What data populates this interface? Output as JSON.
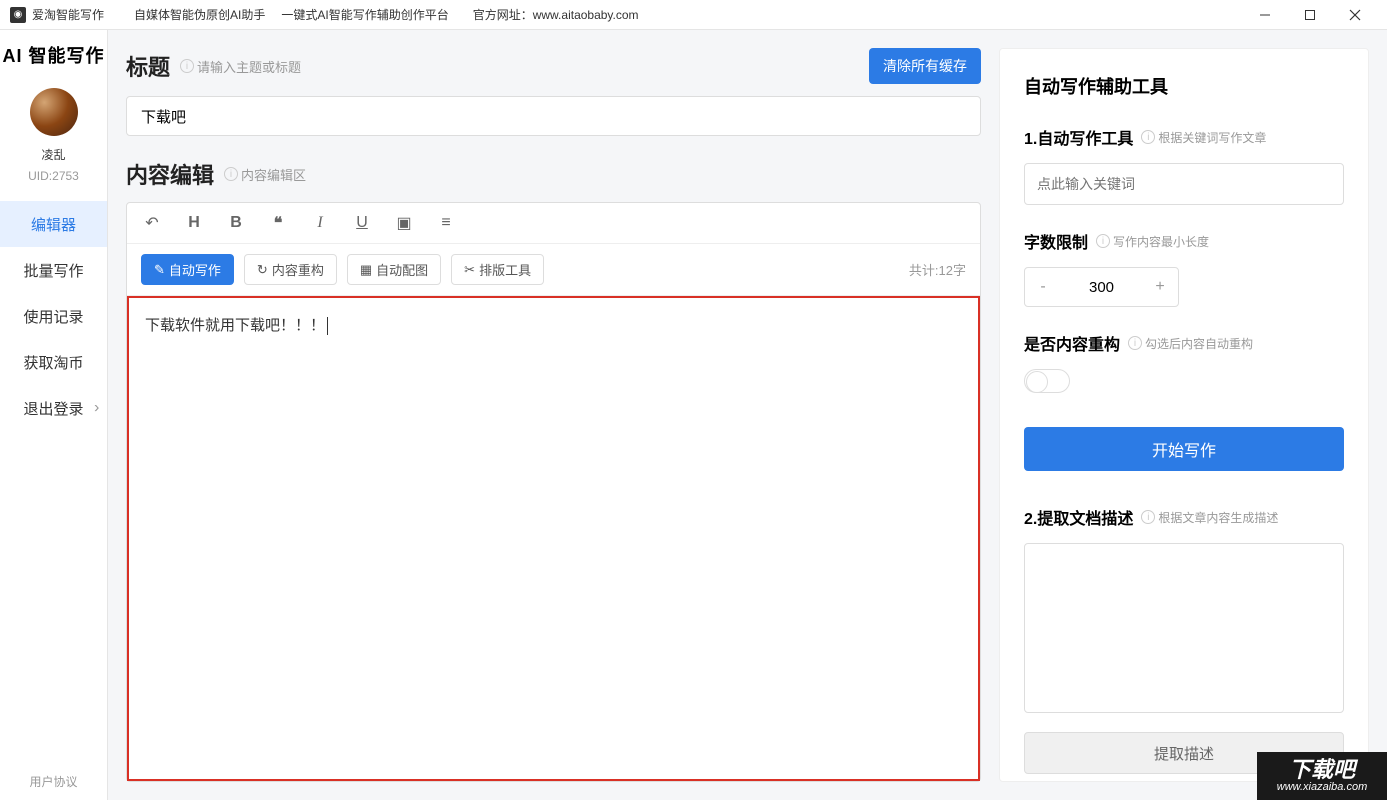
{
  "titlebar": {
    "app_name": "爱淘智能写作",
    "subtitle1": "自媒体智能伪原创AI助手",
    "subtitle2": "一键式AI智能写作辅助创作平台",
    "website_label": "官方网址：",
    "website": "www.aitaobaby.com"
  },
  "sidebar": {
    "logo": "AI 智能写作",
    "username": "凌乱",
    "uid": "UID:2753",
    "nav": {
      "editor": "编辑器",
      "batch": "批量写作",
      "history": "使用记录",
      "coins": "获取淘币",
      "logout": "退出登录"
    },
    "agreement": "用户协议"
  },
  "editor": {
    "title_label": "标题",
    "title_hint": "请输入主题或标题",
    "title_value": "下载吧",
    "clear_cache": "清除所有缓存",
    "content_label": "内容编辑",
    "content_hint": "内容编辑区",
    "actions": {
      "auto_write": "自动写作",
      "restructure": "内容重构",
      "auto_image": "自动配图",
      "layout_tool": "排版工具"
    },
    "char_count": "共计:12字",
    "content_text": "下载软件就用下载吧！！！"
  },
  "side_panel": {
    "title": "自动写作辅助工具",
    "section1": {
      "label": "1.自动写作工具",
      "hint": "根据关键词写作文章",
      "keyword_placeholder": "点此输入关键词"
    },
    "word_limit": {
      "label": "字数限制",
      "hint": "写作内容最小长度",
      "value": "300"
    },
    "restructure": {
      "label": "是否内容重构",
      "hint": "勾选后内容自动重构"
    },
    "start_button": "开始写作",
    "section2": {
      "label": "2.提取文档描述",
      "hint": "根据文章内容生成描述"
    },
    "extract_button": "提取描述"
  },
  "watermark": {
    "main": "下载吧",
    "url": "www.xiazaiba.com"
  }
}
